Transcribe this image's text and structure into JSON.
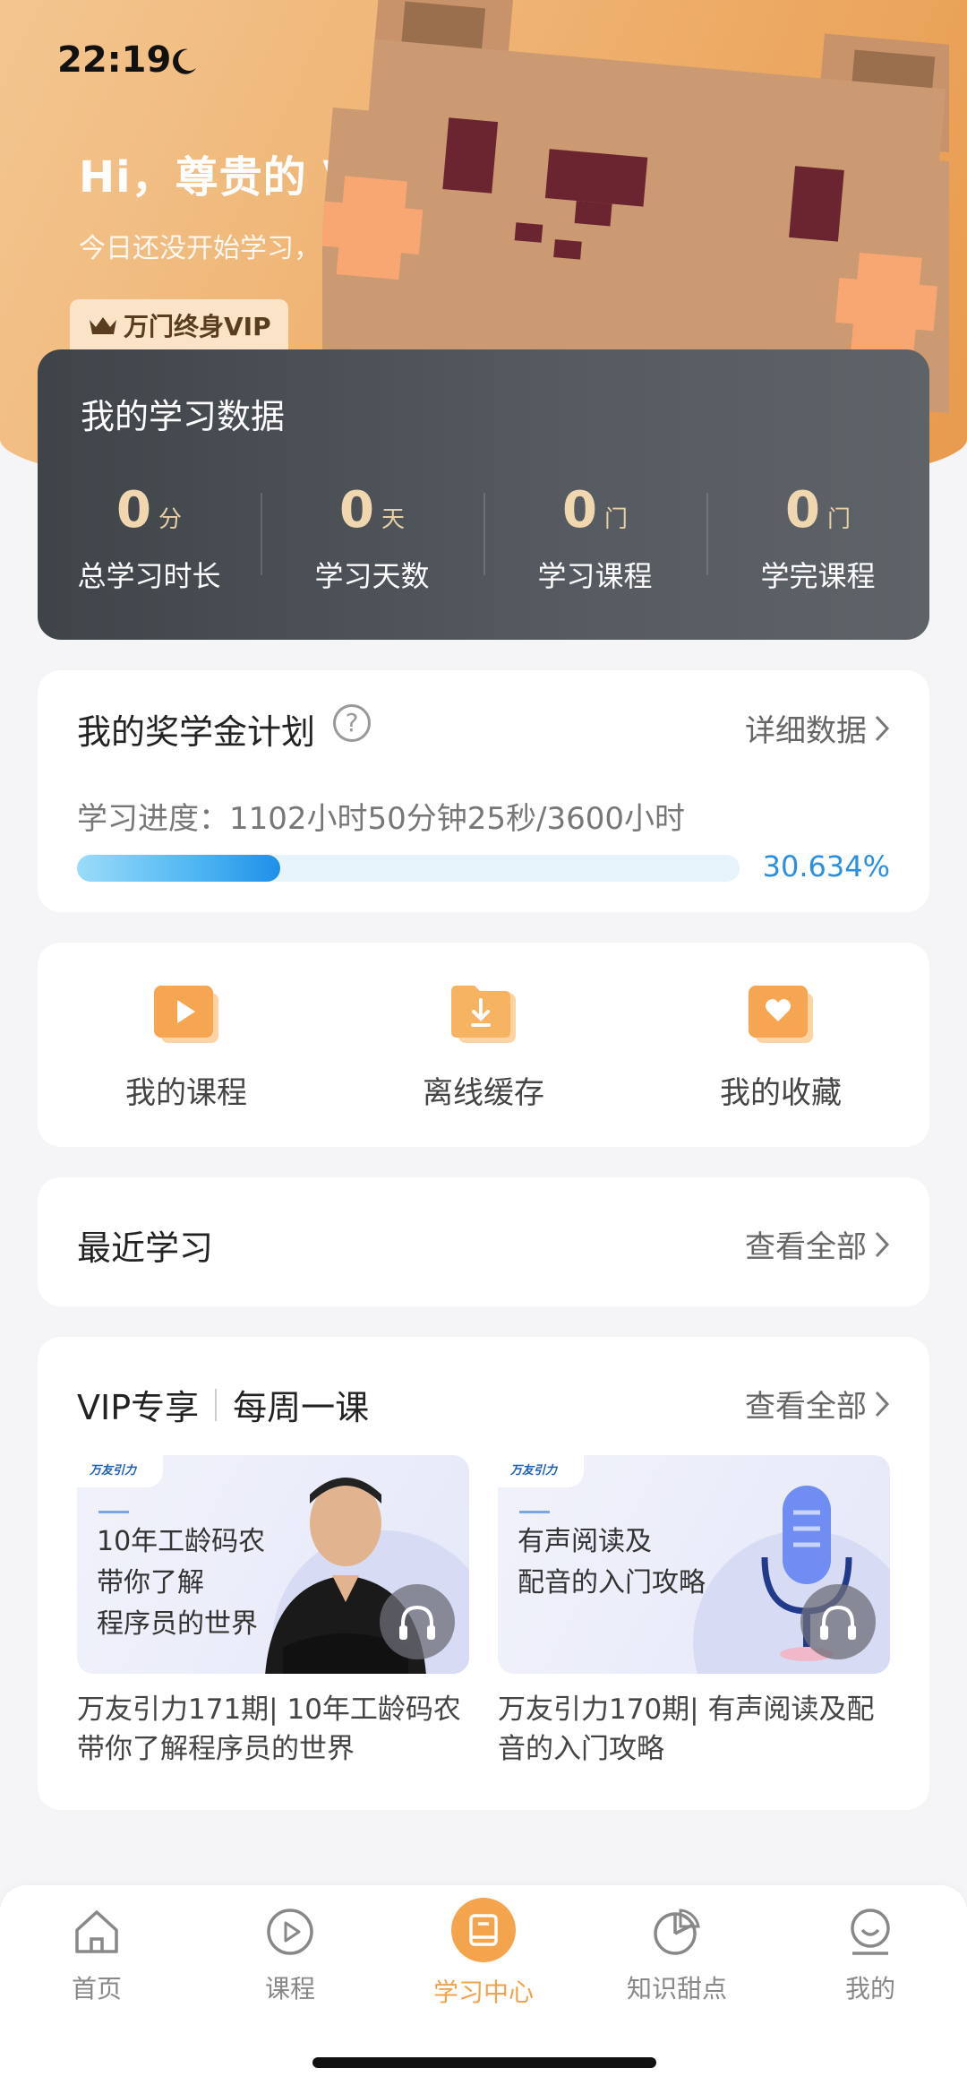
{
  "status": {
    "time": "22:19"
  },
  "header": {
    "greeting": "Hi，尊贵的 VIP",
    "subtitle": "今日还没开始学习，",
    "badge": "万门终身VIP"
  },
  "study_data": {
    "title": "我的学习数据",
    "stats": [
      {
        "value": "0",
        "unit": "分",
        "label": "总学习时长"
      },
      {
        "value": "0",
        "unit": "天",
        "label": "学习天数"
      },
      {
        "value": "0",
        "unit": "门",
        "label": "学习课程"
      },
      {
        "value": "0",
        "unit": "门",
        "label": "学完课程"
      }
    ]
  },
  "scholarship": {
    "title": "我的奖学金计划",
    "help": "?",
    "link": "详细数据",
    "progress_text": "学习进度：1102小时50分钟25秒/3600小时",
    "progress_fraction": 0.30634,
    "progress_pct": "30.634%"
  },
  "quick_actions": [
    {
      "label": "我的课程",
      "icon": "play-folder-icon"
    },
    {
      "label": "离线缓存",
      "icon": "download-folder-icon"
    },
    {
      "label": "我的收藏",
      "icon": "heart-folder-icon"
    }
  ],
  "recent": {
    "title": "最近学习",
    "link": "查看全部"
  },
  "vip_section": {
    "title_left": "VIP专享",
    "title_right": "每周一课",
    "link": "查看全部",
    "courses": [
      {
        "brand": "万友引力",
        "thumb_text": "10年工龄码农\n带你了解\n程序员的世界",
        "caption": "万友引力171期| 10年工龄码农带你了解程序员的世界"
      },
      {
        "brand": "万友引力",
        "thumb_text": "有声阅读及\n配音的入门攻略",
        "caption": "万友引力170期| 有声阅读及配音的入门攻略"
      }
    ]
  },
  "tabbar": [
    {
      "label": "首页",
      "icon": "home-icon"
    },
    {
      "label": "课程",
      "icon": "play-circle-icon"
    },
    {
      "label": "学习中心",
      "icon": "book-icon",
      "active": true
    },
    {
      "label": "知识甜点",
      "icon": "pie-icon"
    },
    {
      "label": "我的",
      "icon": "profile-icon"
    }
  ],
  "colors": {
    "accent": "#f0a34a",
    "progress": "#2b8fe0",
    "data_card": "#4a4f55"
  }
}
